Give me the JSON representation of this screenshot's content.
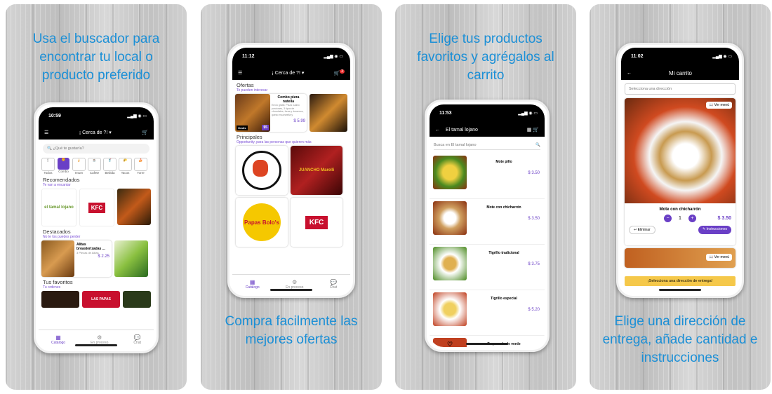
{
  "panels": [
    {
      "caption": "Usa el buscador para encontrar tu local o producto preferido"
    },
    {
      "caption": "Compra facilmente las mejores ofertas"
    },
    {
      "caption": "Elige tus productos favoritos y agrégalos al carrito"
    },
    {
      "caption": "Elige una dirección de entrega, añade cantidad e instrucciones"
    }
  ],
  "screen1": {
    "time": "10:59",
    "location": "¡ Cerca de ?!",
    "search_placeholder": "¿Qué te gustaría?",
    "categories": [
      "Todos",
      "Combo",
      "Imum",
      "Cafete",
      "Bebida",
      "Tacos",
      "Torre"
    ],
    "recomendados": {
      "title": "Recomendados",
      "sub": "Te van a encantar"
    },
    "destacados": {
      "title": "Destacados",
      "sub": "No te los puedes perder"
    },
    "featured": {
      "name": "Alitas broasterizadas ...",
      "desc": "3 Piezas de Alitas",
      "price": "$ 2.25"
    },
    "favoritos": {
      "title": "Tus favoritos",
      "sub": "Tu ordenes"
    },
    "fav_label": "LAS PAPAS",
    "logos": {
      "tamal": "el tamal lojano",
      "kfc": "KFC"
    },
    "tabs": [
      "Catálogo",
      "En proceso",
      "Chat"
    ]
  },
  "screen2": {
    "time": "11:12",
    "location": "¡ Cerca de ?!",
    "badge": "3",
    "ofertas": {
      "title": "Ofertas",
      "sub": "Te pueden interesar"
    },
    "offer": {
      "name": "Combo pizza nutella",
      "desc": "Envío gratis: Pizza cuatro porciones, 3 tipos de chocolates, fresa y duraznos, queso mozzarella y",
      "price": "$ 5.99",
      "tag": "$5",
      "gratis": "Gratis"
    },
    "principales": {
      "title": "Principales",
      "sub": "Opportunity, para las personas que quieren más"
    },
    "logos": {
      "papas": "Papas Bolo's",
      "kfc": "KFC",
      "juancho": "JUANCHO Marelli"
    },
    "tabs": [
      "Catálogo",
      "En proceso",
      "Chat"
    ]
  },
  "screen3": {
    "time": "11:53",
    "title": "El tamal lojano",
    "search_placeholder": "Busca en El tamal lojano",
    "products": [
      {
        "name": "Mote pillo",
        "price": "$ 3.50"
      },
      {
        "name": "Mote con chicharrón",
        "price": "$ 3.50"
      },
      {
        "name": "Tigrillo tradicional",
        "price": "$ 3.75"
      },
      {
        "name": "Tigrillo especial",
        "price": "$ 5.20"
      },
      {
        "name": "Empanada de verde",
        "price": ""
      }
    ]
  },
  "screen4": {
    "time": "11:02",
    "title": "Mi carrito",
    "address_placeholder": "Selecciona una dirección",
    "ver_menu": "Ver menú",
    "item": {
      "name": "Mote con chicharrón",
      "qty": "1",
      "price": "$ 3.50"
    },
    "eliminar": "Eliminar",
    "instrucciones": "Instrucciones",
    "ver_menu2": "Ver menú",
    "bottom": "¡Selecciona una dirección de entrega!"
  },
  "colors": {
    "accent": "#6a3fc6",
    "caption": "#1b8fd6"
  }
}
